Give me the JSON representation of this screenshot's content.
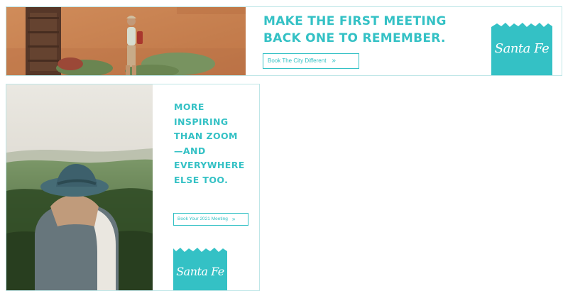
{
  "banners": {
    "top": {
      "headline": [
        "MAKE THE FIRST MEETING",
        "BACK ONE TO REMEMBER."
      ],
      "cta": {
        "label": "Book The City Different",
        "icon": "chevrons-right-icon"
      },
      "logo": {
        "text": "Santa Fe"
      }
    },
    "left": {
      "headline": [
        "MORE",
        "INSPIRING",
        "THAN ZOOM",
        "—AND",
        "EVERYWHERE",
        "ELSE TOO."
      ],
      "cta": {
        "label": "Book Your 2021 Meeting",
        "icon": "chevrons-right-icon"
      },
      "logo": {
        "text": "Santa Fe"
      }
    }
  },
  "colors": {
    "accent": "#34c1c5",
    "border": "#bfe6e7"
  }
}
